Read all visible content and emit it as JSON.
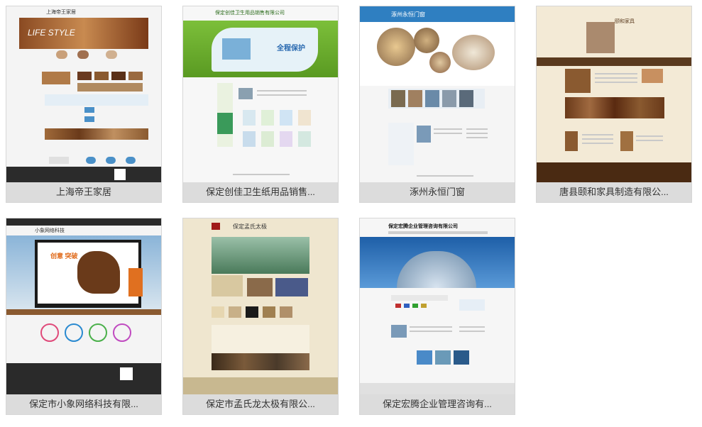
{
  "cards": [
    {
      "caption": "上海帝王家居",
      "thumb_title": "上海帝王家居",
      "banner_text": "LIFE STYLE",
      "accent": "#4a90c8"
    },
    {
      "caption": "保定创佳卫生纸用品销售...",
      "thumb_title": "保定创佳卫生用品销售有限公司",
      "banner_text": "全程保护",
      "accent": "#6aa832"
    },
    {
      "caption": "涿州永恒门窗",
      "thumb_title": "涿州永恒门窗",
      "accent": "#2f7fc1"
    },
    {
      "caption": "唐县颐和家具制造有限公...",
      "thumb_title": "颐和家具",
      "accent": "#5a3a1e"
    },
    {
      "caption": "保定市小象网络科技有限...",
      "thumb_title": "小象网络科技",
      "banner_text": "创意 突破",
      "accent": "#2a2a2a"
    },
    {
      "caption": "保定市孟氏龙太极有限公...",
      "thumb_title": "保定孟氏太极",
      "accent": "#8a6a3c"
    },
    {
      "caption": "保定宏腾企业管理咨询有...",
      "thumb_title": "保定宏腾企业管理咨询有限公司",
      "accent": "#1e5fa8"
    }
  ]
}
